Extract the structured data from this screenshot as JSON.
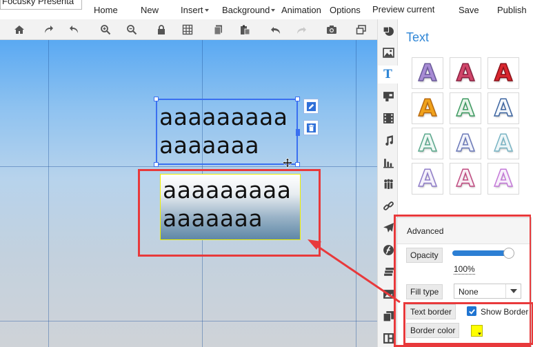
{
  "app": {
    "title": "Focusky Presenta"
  },
  "menu": {
    "home": "Home",
    "new": "New",
    "insert": "Insert",
    "background": "Background",
    "animation": "Animation",
    "options": "Options",
    "preview_current": "Preview current",
    "save": "Save",
    "publish": "Publish"
  },
  "toolbar": {
    "icons": [
      "home-icon",
      "redo-curved-icon",
      "undo-curved-icon",
      "zoom-in-icon",
      "zoom-out-icon",
      "lock-icon",
      "grid-icon",
      "copy-icon",
      "paste-icon",
      "undo-icon",
      "redo-icon",
      "camera-icon",
      "window-icon"
    ]
  },
  "canvas": {
    "selected_text_line1": "aaaaaaaaa",
    "selected_text_line2": "aaaaaaa",
    "second_text_line1": "aaaaaaaaa",
    "second_text_line2": "aaaaaaa",
    "second_border_color": "#f0f000"
  },
  "rail": {
    "icons": [
      "shape-icon",
      "image-icon",
      "text-icon",
      "media-icon",
      "video-icon",
      "music-icon",
      "chart-icon",
      "people-icon",
      "link-icon",
      "plane-icon",
      "flash-icon",
      "layers-icon",
      "pages-icon",
      "layout-icon"
    ],
    "active": "text-icon"
  },
  "panel": {
    "title": "Text",
    "styles": [
      {
        "color": "#a78bd4",
        "stroke": "#6a5a9a"
      },
      {
        "color": "#d0466a",
        "stroke": "#8a2040"
      },
      {
        "color": "#d8262e",
        "stroke": "#8a1018"
      },
      {
        "color": "#f0a21b",
        "stroke": "#b86a10"
      },
      {
        "color": "#e8f4ea",
        "stroke": "#3c9a60"
      },
      {
        "color": "#f4f8fc",
        "stroke": "#3c64a0"
      },
      {
        "color": "#eef8f4",
        "stroke": "#5aa88c"
      },
      {
        "color": "#f2f4fb",
        "stroke": "#6a78b8"
      },
      {
        "color": "#eef6f8",
        "stroke": "#78b4c4"
      },
      {
        "color": "#f5f2fb",
        "stroke": "#8f7cc8"
      },
      {
        "color": "#f8eef4",
        "stroke": "#c04a80"
      },
      {
        "color": "#f8f0fb",
        "stroke": "#c478d8"
      }
    ]
  },
  "advanced": {
    "title": "Advanced",
    "opacity_label": "Opacity",
    "opacity_value": "100%",
    "opacity_fraction": 1.0,
    "fill_type_label": "Fill type",
    "fill_type_value": "None",
    "text_border_label": "Text border",
    "show_border_label": "Show Border",
    "show_border_checked": true,
    "border_color_label": "Border color",
    "border_color": "#ffff00"
  },
  "colors": {
    "accent": "#2f86d6",
    "annotation": "#e8393b"
  }
}
